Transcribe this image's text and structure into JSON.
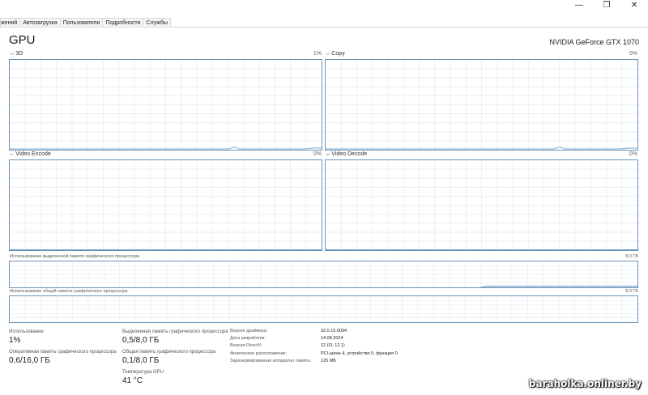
{
  "window": {
    "controls": {
      "minimize": "—",
      "maximize": "❐",
      "close": "✕"
    }
  },
  "tabs": [
    {
      "label": "жений"
    },
    {
      "label": "Автозагрузка"
    },
    {
      "label": "Пользователи"
    },
    {
      "label": "Подробности"
    },
    {
      "label": "Службы"
    }
  ],
  "header": {
    "title": "GPU",
    "gpu_name": "NVIDIA GeForce GTX 1070"
  },
  "graphs": {
    "g3d": {
      "label": "3D",
      "percent": "1%"
    },
    "copy": {
      "label": "Copy",
      "percent": "0%"
    },
    "encode": {
      "label": "Video Encode",
      "percent": "0%"
    },
    "decode": {
      "label": "Video Decode",
      "percent": "0%"
    }
  },
  "memory_graphs": {
    "dedicated": {
      "label": "Использование выделенной памяти графического процессора",
      "max": "8,0 ГБ",
      "level": 0.06
    },
    "shared": {
      "label": "Использование общей памяти графического процессора",
      "max": "8,0 ГБ",
      "level": 0.0
    }
  },
  "stats": {
    "usage": {
      "label": "Использование",
      "value": "1%"
    },
    "gpu_memory": {
      "label": "Оперативная память графического процессора",
      "value": "0,6/16,0 ГБ"
    },
    "dedicated": {
      "label": "Выделенная память графического процессора",
      "value": "0,5/8,0 ГБ"
    },
    "shared": {
      "label": "Общая память графического процессора",
      "value": "0,1/8,0 ГБ"
    },
    "temperature": {
      "label": "Температура GPU",
      "value": "41 °C"
    }
  },
  "properties": [
    {
      "key": "Версия драйвера:",
      "value": "32.0.15.6094"
    },
    {
      "key": "Дата разработки:",
      "value": "14.08.2024"
    },
    {
      "key": "Версия DirectX:",
      "value": "12 (FL 12.1)"
    },
    {
      "key": "Физическое расположение:",
      "value": "PCI-шина 4, устройство 0, функция 0"
    },
    {
      "key": "Зарезервированная аппаратно память:",
      "value": "125 МБ"
    }
  ],
  "watermark": "baraholka.onliner.by",
  "colors": {
    "grid": "#e3ecf4",
    "border": "#6b93b8",
    "line": "#7ba7cf"
  }
}
